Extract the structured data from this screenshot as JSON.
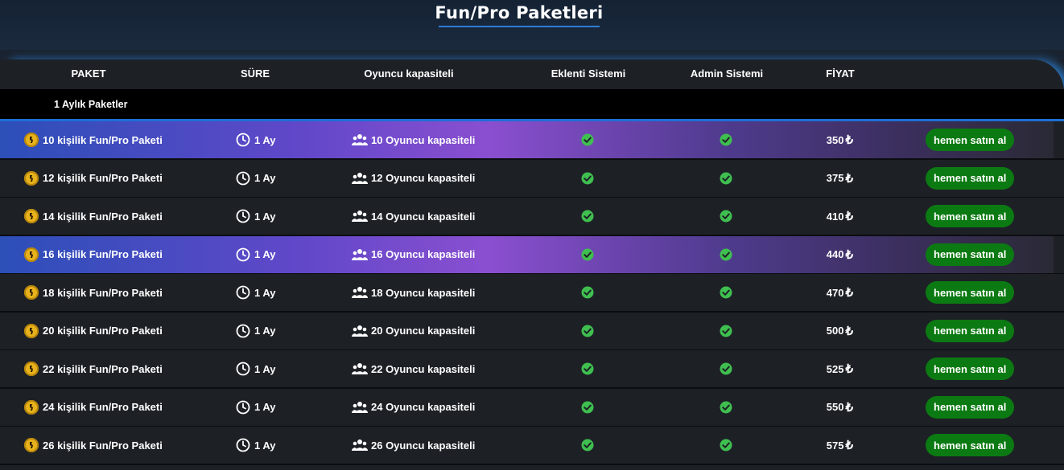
{
  "page": {
    "title": "Fun/Pro Paketleri"
  },
  "columns": [
    "PAKET",
    "SÜRE",
    "Oyuncu kapasiteli",
    "Eklenti Sistemi",
    "Admin Sistemi",
    "FİYAT"
  ],
  "group_label": "1 Aylık Paketler",
  "colors": {
    "accent_blue": "#1d6fd6",
    "button_green": "#0c7a12",
    "check_green": "#3fbf4f",
    "highlight_start": "#2c4fb8",
    "highlight_mid": "#8a4fd0"
  },
  "icons": {
    "package": "counter-strike-icon",
    "duration": "clock-icon",
    "capacity": "users-icon",
    "feature": "check-circle-icon"
  },
  "packages": [
    {
      "name": "10 kişilik Fun/Pro Paketi",
      "duration": "1 Ay",
      "capacity": "10 Oyuncu kapasiteli",
      "price": "350",
      "currency": "₺",
      "button": "hemen satın al",
      "highlighted": true
    },
    {
      "name": "12 kişilik Fun/Pro Paketi",
      "duration": "1 Ay",
      "capacity": "12 Oyuncu kapasiteli",
      "price": "375",
      "currency": "₺",
      "button": "hemen satın al",
      "highlighted": false
    },
    {
      "name": "14 kişilik Fun/Pro Paketi",
      "duration": "1 Ay",
      "capacity": "14 Oyuncu kapasiteli",
      "price": "410",
      "currency": "₺",
      "button": "hemen satın al",
      "highlighted": false
    },
    {
      "name": "16 kişilik Fun/Pro Paketi",
      "duration": "1 Ay",
      "capacity": "16 Oyuncu kapasiteli",
      "price": "440",
      "currency": "₺",
      "button": "hemen satın al",
      "highlighted": true
    },
    {
      "name": "18 kişilik Fun/Pro Paketi",
      "duration": "1 Ay",
      "capacity": "18 Oyuncu kapasiteli",
      "price": "470",
      "currency": "₺",
      "button": "hemen satın al",
      "highlighted": false
    },
    {
      "name": "20 kişilik Fun/Pro Paketi",
      "duration": "1 Ay",
      "capacity": "20 Oyuncu kapasiteli",
      "price": "500",
      "currency": "₺",
      "button": "hemen satın al",
      "highlighted": false
    },
    {
      "name": "22 kişilik Fun/Pro Paketi",
      "duration": "1 Ay",
      "capacity": "22 Oyuncu kapasiteli",
      "price": "525",
      "currency": "₺",
      "button": "hemen satın al",
      "highlighted": false
    },
    {
      "name": "24 kişilik Fun/Pro Paketi",
      "duration": "1 Ay",
      "capacity": "24 Oyuncu kapasiteli",
      "price": "550",
      "currency": "₺",
      "button": "hemen satın al",
      "highlighted": false
    },
    {
      "name": "26 kişilik Fun/Pro Paketi",
      "duration": "1 Ay",
      "capacity": "26 Oyuncu kapasiteli",
      "price": "575",
      "currency": "₺",
      "button": "hemen satın al",
      "highlighted": false
    }
  ]
}
